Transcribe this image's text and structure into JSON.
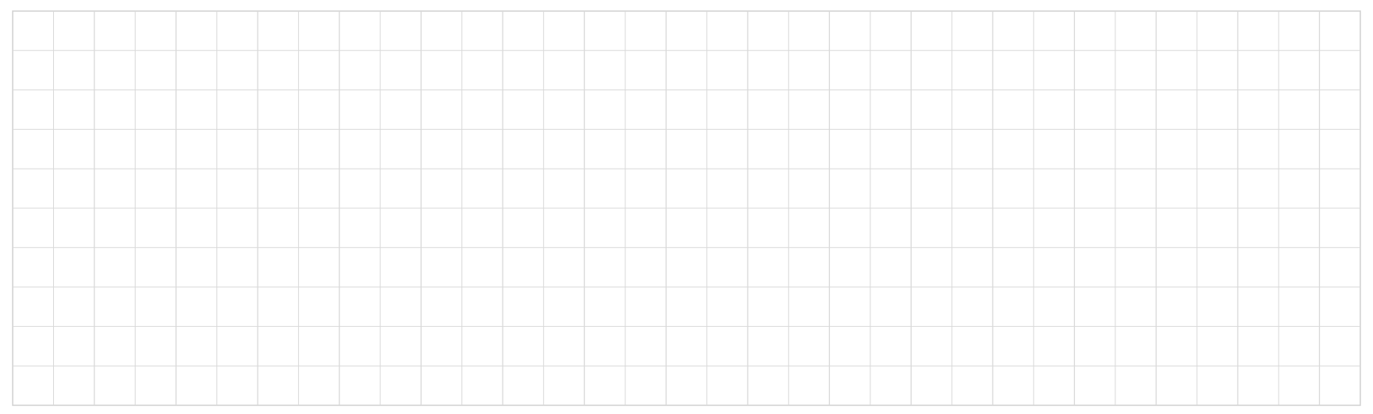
{
  "grid": {
    "columns": 33,
    "rows": 10,
    "line_color": "#d9d9d9",
    "major_line_color": "#d0d0d0",
    "background": "#ffffff",
    "cells_filled": 0
  }
}
